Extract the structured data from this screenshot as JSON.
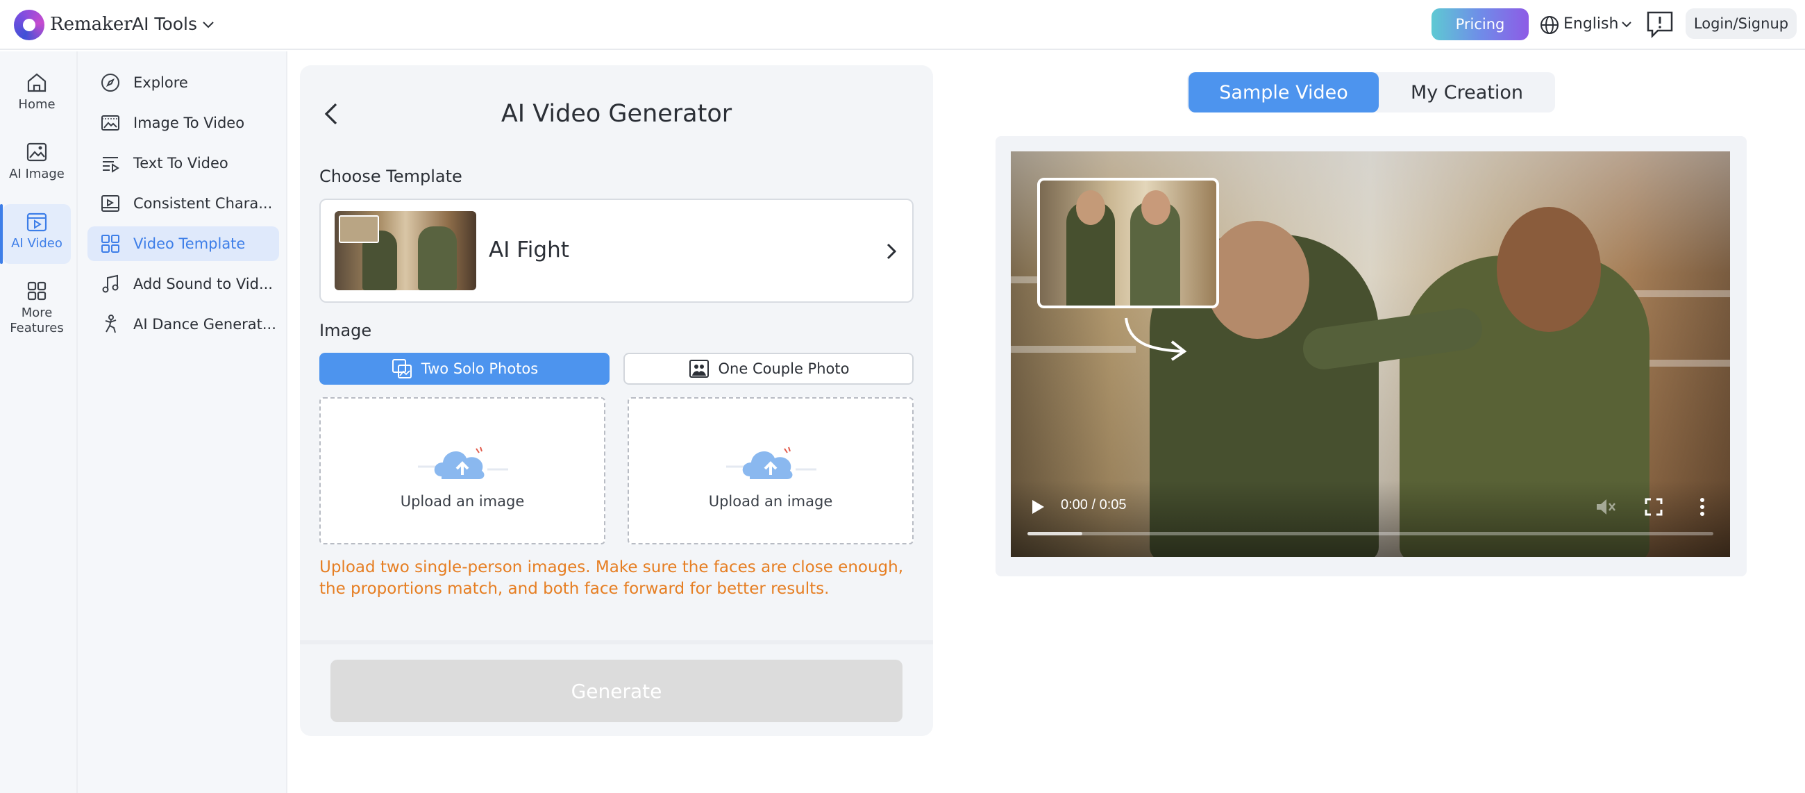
{
  "header": {
    "brand": "Remaker",
    "tools_label": "AI Tools",
    "pricing_label": "Pricing",
    "language": "English",
    "login_label": "Login/Signup"
  },
  "rail": {
    "items": [
      {
        "label": "Home",
        "icon": "home-icon"
      },
      {
        "label": "AI Image",
        "icon": "image-icon"
      },
      {
        "label": "AI Video",
        "icon": "video-icon",
        "active": true
      },
      {
        "label": "More\nFeatures",
        "icon": "grid-icon"
      }
    ]
  },
  "submenu": {
    "items": [
      {
        "label": "Explore",
        "icon": "compass-icon"
      },
      {
        "label": "Image To Video",
        "icon": "image-to-video-icon"
      },
      {
        "label": "Text To Video",
        "icon": "text-to-video-icon"
      },
      {
        "label": "Consistent Chara...",
        "icon": "character-icon"
      },
      {
        "label": "Video Template",
        "icon": "template-icon",
        "active": true
      },
      {
        "label": "Add Sound to Vid...",
        "icon": "music-icon"
      },
      {
        "label": "AI Dance Generat...",
        "icon": "dance-icon"
      }
    ]
  },
  "panel": {
    "title": "AI Video Generator",
    "choose_template_label": "Choose Template",
    "template_name": "AI Fight",
    "image_label": "Image",
    "tab_two_solo": "Two Solo Photos",
    "tab_one_couple": "One Couple Photo",
    "upload_label_1": "Upload an image",
    "upload_label_2": "Upload an image",
    "hint": "Upload two single-person images. Make sure the faces are close enough, the proportions match, and both face forward for better results.",
    "generate_label": "Generate"
  },
  "preview": {
    "tab_sample": "Sample Video",
    "tab_creation": "My Creation",
    "time": "0:00 / 0:05",
    "progress": 0.08
  },
  "colors": {
    "accent": "#4d94ee",
    "hint": "#e67e22",
    "active_nav": "#3d7ee8"
  }
}
